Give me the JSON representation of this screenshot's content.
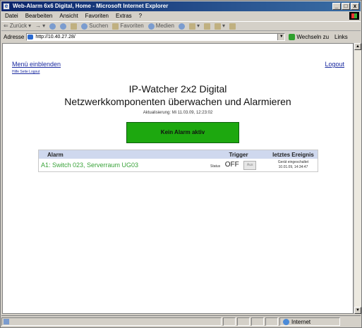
{
  "window": {
    "title": "Web-Alarm 6x6 Digital, Home - Microsoft Internet Explorer",
    "controls": [
      "_",
      "□",
      "x"
    ]
  },
  "menu": [
    "Datei",
    "Bearbeiten",
    "Ansicht",
    "Favoriten",
    "Extras",
    "?"
  ],
  "toolbar": {
    "back": "Zurück",
    "search": "Suchen",
    "favorites": "Favoriten",
    "media": "Medien"
  },
  "address": {
    "label": "Adresse",
    "value": "http://10.40.27.28/",
    "go": "Wechseln zu",
    "links": "Links"
  },
  "page": {
    "menu_link": "Menü einblenden",
    "sub_links": "Hilfe  Seite Logout",
    "logout": "Logout",
    "title": "IP-Watcher 2x2 Digital",
    "subtitle": "Netzwerkkomponenten überwachen und Alarmieren",
    "update": "Aktualisierung: Mi 11.03.09, 12:23:02",
    "status": "Kein Alarm aktiv"
  },
  "table": {
    "headers": [
      "Alarm",
      "Trigger",
      "letztes Ereignis"
    ],
    "rows": [
      {
        "name": "A1: Switch 023, Serverraum UG03",
        "trigger_label": "Status",
        "trigger_value": "OFF",
        "trigger_button": "Aus",
        "event_line1": "Gerät eingeschaltet",
        "event_line2": "10.01.09, 14:34:47"
      }
    ]
  },
  "status": {
    "zone": "Internet"
  },
  "colors": {
    "title_bar": "#0a246a",
    "status_ok": "#1da80f",
    "link": "#1a2aa0",
    "table_header": "#cfd8ee",
    "alarm_text": "#3aa33a"
  }
}
